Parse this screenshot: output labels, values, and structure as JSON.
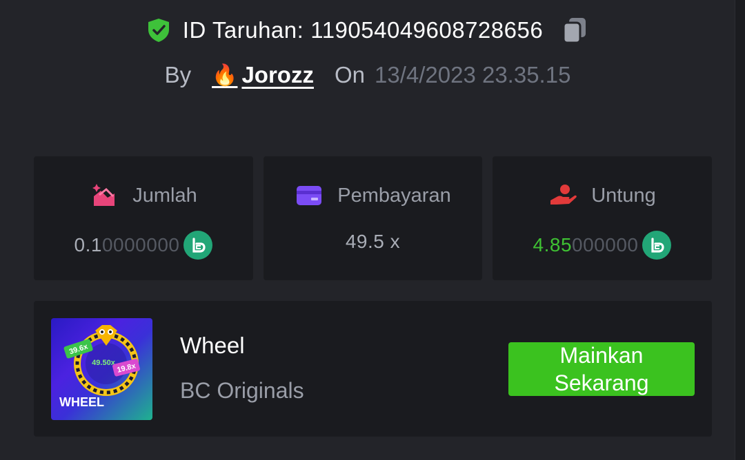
{
  "header": {
    "bet_id_label": "ID Taruhan:",
    "bet_id": "119054049608728656",
    "by_label": "By",
    "username": "Jorozz",
    "on_label": "On",
    "datetime": "13/4/2023 23.35.15"
  },
  "stats": {
    "amount": {
      "label": "Jumlah",
      "value_bright": "0.1",
      "value_dim": "0000000"
    },
    "payout": {
      "label": "Pembayaran",
      "value": "49.5 x"
    },
    "profit": {
      "label": "Untung",
      "value_bright": "4.85",
      "value_dim": "000000"
    }
  },
  "game": {
    "title": "Wheel",
    "provider": "BC Originals",
    "thumb_title": "WHEEL",
    "thumb_labels": [
      "39.6x",
      "49.50x",
      "19.8x"
    ],
    "play_label_line1": "Mainkan",
    "play_label_line2": "Sekarang"
  },
  "colors": {
    "accent_green": "#3bc21f",
    "profit_green": "#3fc233",
    "coin_green": "#22a677",
    "shield_green": "#3ec13a",
    "amount_icon": "#e8457a",
    "payout_icon": "#7b4cf5",
    "profit_icon": "#e23a3a"
  },
  "icons": {
    "shield": "shield-check-icon",
    "copy": "copy-icon",
    "fire": "fire-icon",
    "amount": "bet-amount-icon",
    "payout": "wallet-card-icon",
    "profit": "profit-hand-icon",
    "coin": "bc-coin-icon"
  }
}
